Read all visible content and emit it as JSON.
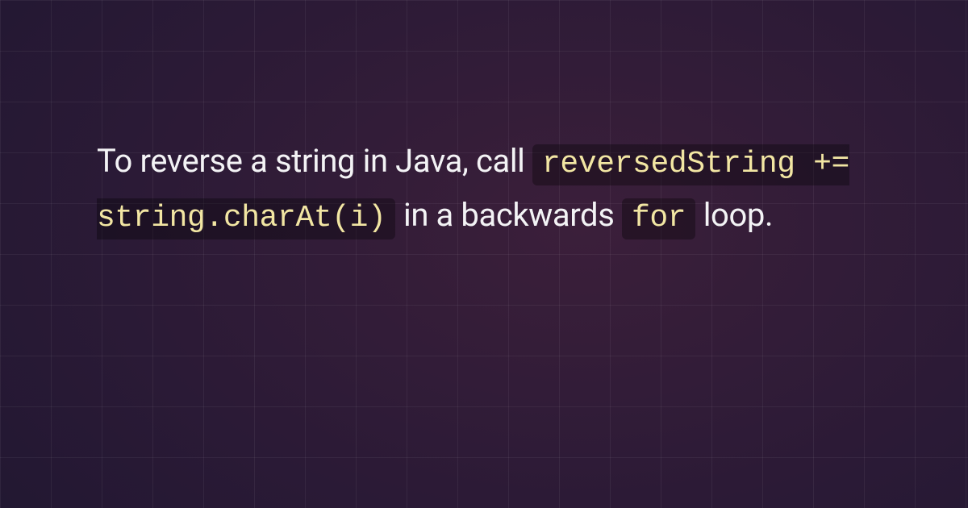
{
  "card": {
    "text_before_code1": "To reverse a string in Java, call ",
    "code1": "reversedString += string.charAt(i)",
    "text_between": " in a backwards ",
    "code2": "for",
    "text_after": " loop."
  }
}
